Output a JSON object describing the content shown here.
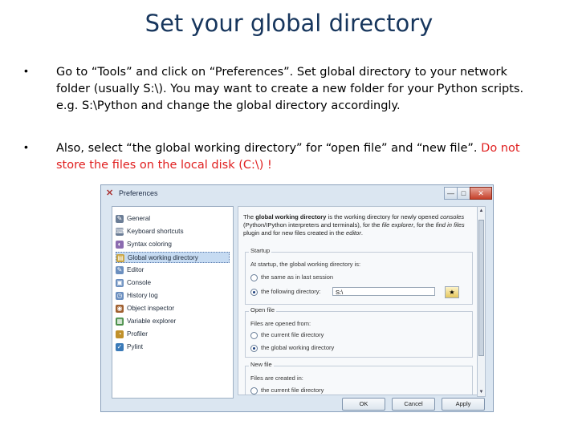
{
  "slide": {
    "title": "Set your global directory",
    "bullets": [
      {
        "marker": "•",
        "text": "Go to “Tools” and click on “Preferences”. Set global directory to your network folder (usually S:\\). You may want to create a new folder for your Python scripts. e.g. S:\\Python and change the global directory accordingly."
      },
      {
        "marker": "•",
        "text_a": "Also, select “the global working directory” for “open file” and “new file”. ",
        "text_b": "Do not store the files on the local disk (C:\\) !"
      }
    ]
  },
  "dialog": {
    "title": "Preferences",
    "app_icon": "spyder-icon",
    "window_buttons": {
      "minimize": "—",
      "maximize": "□",
      "close": "✕"
    },
    "sidebar": [
      {
        "label": "General",
        "icon": "wrench-icon",
        "color": "#6b7d96"
      },
      {
        "label": "Keyboard shortcuts",
        "icon": "keyboard-icon",
        "color": "#6b7d96"
      },
      {
        "label": "Syntax coloring",
        "icon": "palette-icon",
        "color": "#8b6bb0"
      },
      {
        "label": "Global working directory",
        "icon": "folder-icon",
        "color": "#c9a33d",
        "selected": true
      },
      {
        "label": "Editor",
        "icon": "editor-icon",
        "color": "#6b8fbf"
      },
      {
        "label": "Console",
        "icon": "console-icon",
        "color": "#6b8fbf"
      },
      {
        "label": "History log",
        "icon": "history-icon",
        "color": "#6b8fbf"
      },
      {
        "label": "Object inspector",
        "icon": "inspector-icon",
        "color": "#a06030"
      },
      {
        "label": "Variable explorer",
        "icon": "variable-icon",
        "color": "#4a8f4a"
      },
      {
        "label": "Profiler",
        "icon": "profiler-icon",
        "color": "#c0902a"
      },
      {
        "label": "Pylint",
        "icon": "pylint-icon",
        "color": "#3a7ab8"
      }
    ],
    "description_parts": [
      "The ",
      "global working directory",
      " is the working directory for newly opened ",
      "consoles",
      " (Python/IPython interpreters and terminals), for the ",
      "file explorer",
      ", for the ",
      "find in files",
      " plugin and for new files created in the ",
      "editor",
      "."
    ],
    "startup": {
      "title": "Startup",
      "label": "At startup, the global working directory is:",
      "opt_last": "the same as in last session",
      "opt_following": "the following directory:",
      "directory_value": "S:\\",
      "browse_icon": "folder-open-icon"
    },
    "open_file": {
      "title": "Open file",
      "label": "Files are opened from:",
      "opt_current": "the current file directory",
      "opt_global": "the global working directory"
    },
    "new_file": {
      "title": "New file",
      "label": "Files are created in:",
      "opt_current": "the current file directory"
    },
    "buttons": {
      "ok": "OK",
      "cancel": "Cancel",
      "apply": "Apply"
    }
  }
}
